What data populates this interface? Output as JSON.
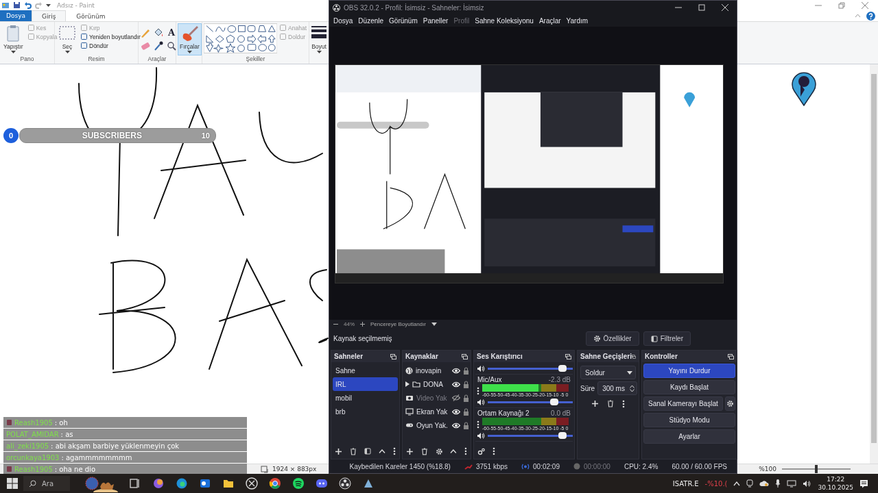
{
  "paint": {
    "title": "Adsız - Paint",
    "file_tab": "Dosya",
    "tabs": [
      {
        "label": "Giriş",
        "selected": true
      },
      {
        "label": "Görünüm",
        "selected": false
      }
    ],
    "groups": [
      {
        "kind": "clipboard",
        "label": "Pano",
        "big": "Yapıştır",
        "small": [
          {
            "label": "Kes",
            "disabled": true
          },
          {
            "label": "Kopyala",
            "disabled": true
          }
        ]
      },
      {
        "kind": "image",
        "label": "Resim",
        "big": "Seç",
        "small": [
          {
            "label": "Kırp",
            "disabled": true
          },
          {
            "label": "Yeniden boyutlandır",
            "disabled": false
          },
          {
            "label": "Döndür",
            "disabled": false
          }
        ]
      },
      {
        "kind": "tools",
        "label": "Araçlar",
        "text_tool": "A"
      },
      {
        "kind": "brushes",
        "big": "Fırçalar",
        "selected": true
      },
      {
        "kind": "shapes",
        "label": "Şekiller",
        "small": [
          {
            "label": "Anahat",
            "disabled": true
          },
          {
            "label": "Doldur",
            "disabled": true
          }
        ]
      },
      {
        "kind": "size",
        "big": "Boyut"
      }
    ],
    "status": {
      "dimensions": "1924 × 883px",
      "zoom": "%100",
      "zoom_slider": {
        "level": 0.5
      }
    }
  },
  "subscribers": {
    "count": "0",
    "label": "SUBSCRIBERS",
    "goal": "10",
    "level": 0
  },
  "chat": [
    {
      "user": "Reash1905",
      "text": ": oh",
      "badge": true
    },
    {
      "user": "POLAT_AMIDAR",
      "text": ": as",
      "badge": false
    },
    {
      "user": "ali_zeki1905",
      "text": ": abi akşam barbiye yüklenmeyin çok",
      "badge": false
    },
    {
      "user": "orcunkaya1903",
      "text": ": agammmmmmmm",
      "badge": false
    },
    {
      "user": "Reash1905",
      "text": ": oha ne dio",
      "badge": true
    }
  ],
  "obs": {
    "title": "OBS 32.0.2 - Profil: İsimsiz - Sahneler: İsimsiz",
    "menu": [
      {
        "label": "Dosya",
        "disabled": false
      },
      {
        "label": "Düzenle",
        "disabled": false
      },
      {
        "label": "Görünüm",
        "disabled": false
      },
      {
        "label": "Paneller",
        "disabled": false
      },
      {
        "label": "Profil",
        "disabled": true
      },
      {
        "label": "Sahne Koleksiyonu",
        "disabled": false
      },
      {
        "label": "Araçlar",
        "disabled": false
      },
      {
        "label": "Yardım",
        "disabled": false
      }
    ],
    "zoom": "44%",
    "zoom_mode": "Pencereye Boyutlandır",
    "source_status": "Kaynak seçilmemiş",
    "source_buttons": [
      "Özellikler",
      "Filtreler"
    ],
    "scenes": {
      "title": "Sahneler",
      "items": [
        {
          "label": "Sahne",
          "selected": false
        },
        {
          "label": "IRL",
          "selected": true
        },
        {
          "label": "mobil",
          "selected": false
        },
        {
          "label": "brb",
          "selected": false
        }
      ]
    },
    "sources": {
      "title": "Kaynaklar",
      "items": [
        {
          "kind": "browser",
          "label": "inovapin",
          "visible": true
        },
        {
          "kind": "group",
          "label": "DONA",
          "visible": true
        },
        {
          "kind": "camera",
          "label": "Video Yak",
          "visible": false
        },
        {
          "kind": "display",
          "label": "Ekran Yak",
          "visible": true
        },
        {
          "kind": "game",
          "label": "Oyun Yak.",
          "visible": true
        }
      ]
    },
    "mixer": {
      "title": "Ses Karıştırıcı",
      "channels": [
        {
          "volume": {
            "level": 0.93
          }
        },
        {
          "name": "Mic/Aux",
          "reading": "-2.3 dB",
          "meter": {
            "level": 0.65
          },
          "scale": "-60-55-50-45-40-35-30-25-20-15-10 -5 0",
          "volume": {
            "level": 0.83
          }
        },
        {
          "name": "Ortam Kaynağı 2",
          "reading": "0.0 dB",
          "meter": {
            "level": 0
          },
          "scale": "-60-55-50-45-40-35-30-25-20-15-10 -5 0",
          "volume": {
            "level": 0.93
          }
        }
      ]
    },
    "transitions": {
      "title": "Sahne Geçişleri",
      "type": "Soldur",
      "duration_label": "Süre",
      "duration": "300 ms"
    },
    "controls": {
      "title": "Kontroller",
      "buttons": [
        {
          "label": "Yayını Durdur",
          "active": true,
          "settings": false
        },
        {
          "label": "Kaydı Başlat",
          "active": false,
          "settings": false
        },
        {
          "label": "Sanal Kamerayı Başlat",
          "active": false,
          "settings": true
        },
        {
          "label": "Stüdyo Modu",
          "active": false,
          "settings": false
        },
        {
          "label": "Ayarlar",
          "active": false,
          "settings": false
        }
      ]
    },
    "status": {
      "dropped": "Kaybedilen Kareler 1450 (%18.8)",
      "bitrate": "3751 kbps",
      "stream_time": "00:02:09",
      "record_time": "00:00:00",
      "cpu": "CPU: 2.4%",
      "fps": "60.00 / 60.00 FPS"
    }
  },
  "taskbar": {
    "search": "Ara",
    "ticker": "ISATR.E",
    "change": "-%10.(",
    "time": "17:22",
    "date": "30.10.2025"
  }
}
